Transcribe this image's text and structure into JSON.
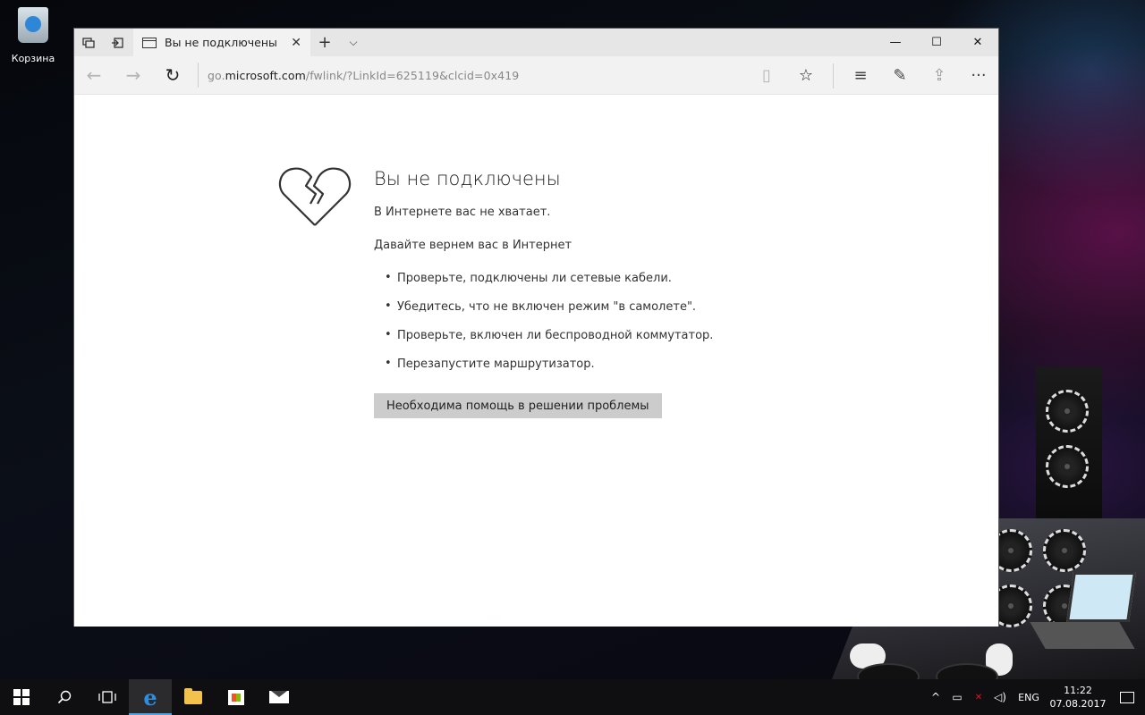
{
  "desktop": {
    "recycle_bin_label": "Корзина"
  },
  "browser": {
    "tab": {
      "title": "Вы не подключены",
      "close_glyph": "✕"
    },
    "new_tab_glyph": "+",
    "tab_list_glyph": "⌵",
    "window_controls": {
      "minimize": "—",
      "maximize": "☐",
      "close": "✕"
    },
    "address": {
      "prefix": "go.",
      "host": "microsoft.com",
      "path": "/fwlink/?LinkId=625119&clcid=0x419"
    },
    "nav": {
      "back": "←",
      "forward": "→",
      "refresh": "↻"
    },
    "toolbar": {
      "reading_view": "▯",
      "favorite": "☆",
      "hub": "≡",
      "notes": "✎",
      "share": "⇪",
      "more": "···"
    }
  },
  "error_page": {
    "title": "Вы не подключены",
    "subtitle": "В Интернете вас не хватает.",
    "lead": "Давайте вернем вас в Интернет",
    "tips": [
      "Проверьте, подключены ли сетевые кабели.",
      "Убедитесь, что не включен режим \"в самолете\".",
      "Проверьте, включен ли беспроводной коммутатор.",
      "Перезапустите маршрутизатор."
    ],
    "help_button": "Необходима помощь в решении проблемы"
  },
  "taskbar": {
    "search_glyph": "⚲",
    "task_view_glyph": "❐",
    "tray": {
      "show_hidden": "^",
      "battery": "▭",
      "network": "✕",
      "volume": "◁)",
      "language": "ENG",
      "time": "11:22",
      "date": "07.08.2017"
    }
  },
  "colors": {
    "edge_blue": "#2d8ee0",
    "help_button_bg": "#cccccc",
    "network_error_red": "#e81123"
  }
}
